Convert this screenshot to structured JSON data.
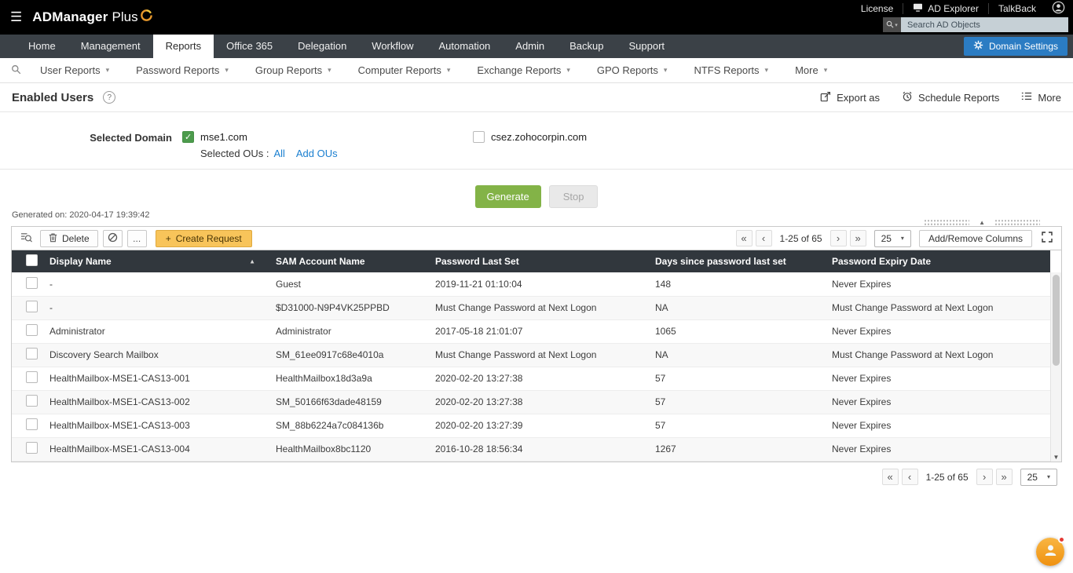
{
  "icons": {
    "hamburger": "☰",
    "caret_down": "▾",
    "sort_asc": "▲",
    "collapse_up": "▲",
    "scroll_down": "▼",
    "help": "?",
    "plus": "+",
    "ellipsis": "..."
  },
  "topbar": {
    "brand_bold": "ADManager",
    "brand_light": "Plus",
    "links": {
      "license": "License",
      "ad_explorer": "AD Explorer",
      "talkback": "TalkBack"
    },
    "search_placeholder": "Search AD Objects"
  },
  "nav": {
    "tabs": [
      {
        "label": "Home"
      },
      {
        "label": "Management"
      },
      {
        "label": "Reports",
        "active": true
      },
      {
        "label": "Office 365"
      },
      {
        "label": "Delegation"
      },
      {
        "label": "Workflow"
      },
      {
        "label": "Automation"
      },
      {
        "label": "Admin"
      },
      {
        "label": "Backup"
      },
      {
        "label": "Support"
      }
    ],
    "domain_settings_label": "Domain Settings"
  },
  "reports_nav": {
    "categories": [
      "User Reports",
      "Password Reports",
      "Group Reports",
      "Computer Reports",
      "Exchange Reports",
      "GPO Reports",
      "NTFS Reports",
      "More"
    ]
  },
  "page": {
    "title": "Enabled Users",
    "export_as_label": "Export as",
    "schedule_reports_label": "Schedule Reports",
    "more_label": "More"
  },
  "domain_selection": {
    "label": "Selected Domain",
    "domains": [
      {
        "name": "mse1.com",
        "checked": true
      },
      {
        "name": "csez.zohocorpin.com",
        "checked": false
      }
    ],
    "selected_ous_label": "Selected OUs :",
    "selected_ous_value": "All",
    "add_ous_label": "Add OUs"
  },
  "generate_section": {
    "generate_label": "Generate",
    "stop_label": "Stop",
    "generated_on": "Generated on: 2020-04-17 19:39:42"
  },
  "toolbar": {
    "delete_label": "Delete",
    "create_request_label": "Create Request",
    "add_remove_columns_label": "Add/Remove Columns"
  },
  "pagination": {
    "first": "«",
    "prev": "‹",
    "range": "1-25 of 65",
    "next": "›",
    "last": "»",
    "page_size": "25"
  },
  "table": {
    "columns": [
      "Display Name",
      "SAM Account Name",
      "Password Last Set",
      "Days since password last set",
      "Password Expiry Date"
    ],
    "rows": [
      [
        "-",
        "Guest",
        "2019-11-21 01:10:04",
        "148",
        "Never Expires"
      ],
      [
        "-",
        "$D31000-N9P4VK25PPBD",
        "Must Change Password at Next Logon",
        "NA",
        "Must Change Password at Next Logon"
      ],
      [
        "Administrator",
        "Administrator",
        "2017-05-18 21:01:07",
        "1065",
        "Never Expires"
      ],
      [
        "Discovery Search Mailbox",
        "SM_61ee0917c68e4010a",
        "Must Change Password at Next Logon",
        "NA",
        "Must Change Password at Next Logon"
      ],
      [
        "HealthMailbox-MSE1-CAS13-001",
        "HealthMailbox18d3a9a",
        "2020-02-20 13:27:38",
        "57",
        "Never Expires"
      ],
      [
        "HealthMailbox-MSE1-CAS13-002",
        "SM_50166f63dade48159",
        "2020-02-20 13:27:38",
        "57",
        "Never Expires"
      ],
      [
        "HealthMailbox-MSE1-CAS13-003",
        "SM_88b6224a7c084136b",
        "2020-02-20 13:27:39",
        "57",
        "Never Expires"
      ],
      [
        "HealthMailbox-MSE1-CAS13-004",
        "HealthMailbox8bc1120",
        "2016-10-28 18:56:34",
        "1267",
        "Never Expires"
      ]
    ]
  }
}
